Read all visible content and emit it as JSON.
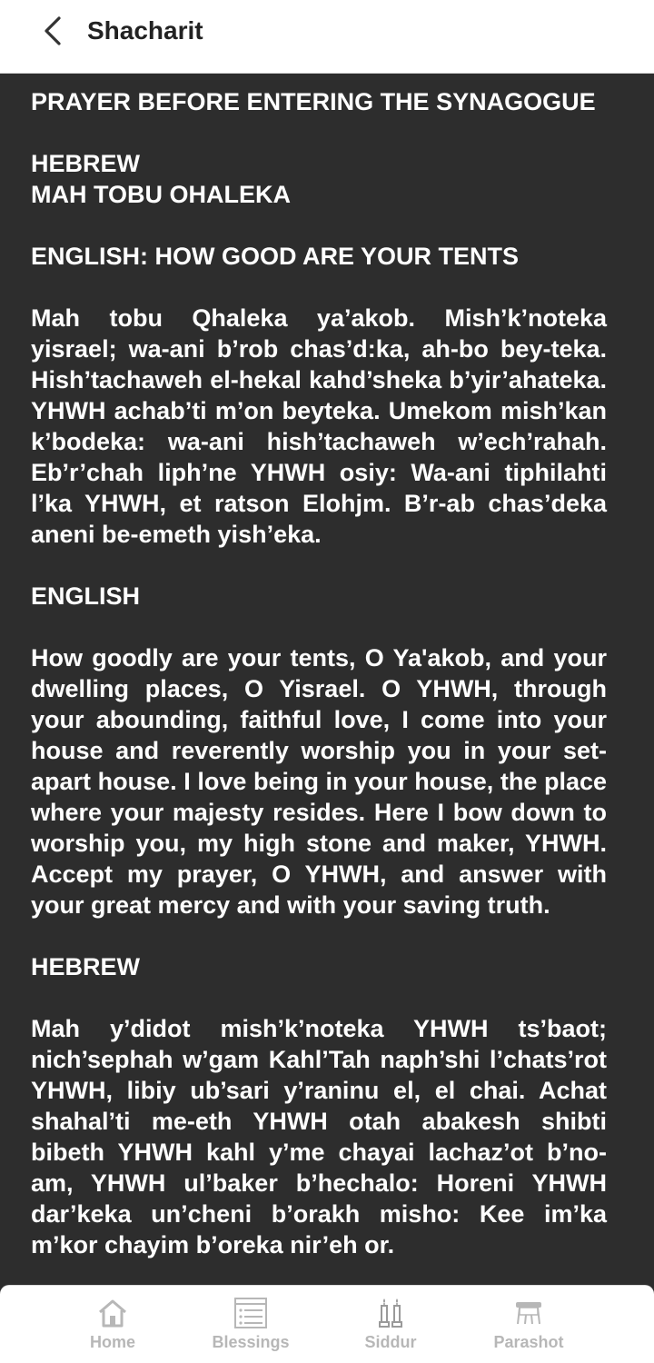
{
  "header": {
    "title": "Shacharit",
    "back_icon": "chevron-left-icon"
  },
  "content": {
    "heading": "PRAYER BEFORE ENTERING THE SYNAGOGUE",
    "section1_label": "HEBREW",
    "section1_title": "MAH TOBU OHALEKA",
    "section2_label": "ENGLISH: HOW GOOD ARE YOUR TENTS",
    "para1": "Mah tobu Qhaleka ya’akob. Mish’k’noteka yisrael; wa-ani b’rob chas’d:ka, ah-bo bey-teka. Hish’tachaweh el-hekal kahd’sheka b’yir’ahateka. YHWH achab’ti m’on beyteka. Umekom mish’kan k’bodeka: wa-ani hish’tachaweh w’ech’rahah. Eb’r’chah liph’ne YHWH osiy: Wa-ani tiphilahti l’ka YHWH, et ratson Elohjm. B’r-ab chas’deka aneni be-emeth yish’eka.",
    "section3_label": "ENGLISH",
    "para2": "How goodly are your tents, O Ya'akob, and your dwelling places, O Yisrael. O YHWH, through your abounding, faithful love, I come into your house and reverently worship you in your set-apart house. I love being in your house, the place where your majesty resides. Here I bow down to worship you, my high stone and maker, YHWH. Accept my prayer, O YHWH, and answer with your great mercy and with your saving truth.",
    "section4_label": "HEBREW",
    "para3": "Mah y’didot mish’k’noteka YHWH ts’baot; nich’sephah w’gam Kahl’Tah naph’shi l’chats’rot YHWH, libiy ub’sari y’raninu el, el chai. Achat shahal’ti me-eth YHWH otah abakesh shibti bibeth YHWH kahl y’me chayai lachaz’ot b’no-am, YHWH ul’baker b’hechalo: Horeni YHWH dar’keka un’cheni b’orakh misho: Kee im’ka m’kor chayim b’oreka nir’eh or."
  },
  "bottom_nav": {
    "items": [
      {
        "label": "Home",
        "icon": "home-icon"
      },
      {
        "label": "Blessings",
        "icon": "list-icon"
      },
      {
        "label": "Siddur",
        "icon": "candles-icon"
      },
      {
        "label": "Parashot",
        "icon": "torah-scroll-icon"
      }
    ]
  },
  "colors": {
    "background": "#2d2d2d",
    "header": "#ffffff",
    "text": "#ffffff",
    "nav_inactive": "#b7b7b7"
  }
}
